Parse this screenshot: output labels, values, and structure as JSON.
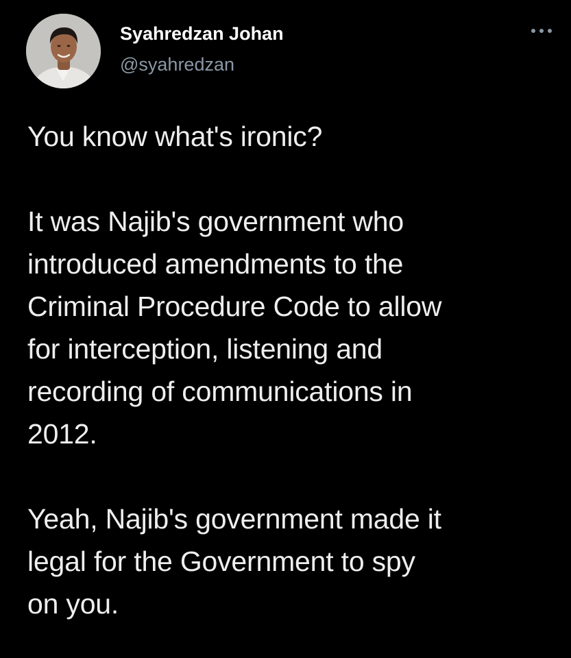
{
  "tweet": {
    "author": {
      "display_name": "Syahredzan Johan",
      "handle": "@syahredzan"
    },
    "menu_icon": "more-horizontal-icon",
    "paragraphs": [
      "You know what's ironic?",
      "It was Najib's government who\nintroduced amendments to the\nCriminal Procedure Code to allow\nfor interception, listening and\nrecording of communications in\n2012.",
      "Yeah, Najib's government made it\nlegal for the Government to spy\non you."
    ]
  },
  "colors": {
    "background": "#000000",
    "name": "#ffffff",
    "handle": "#8b98a5",
    "body_text": "#eeeeee"
  }
}
